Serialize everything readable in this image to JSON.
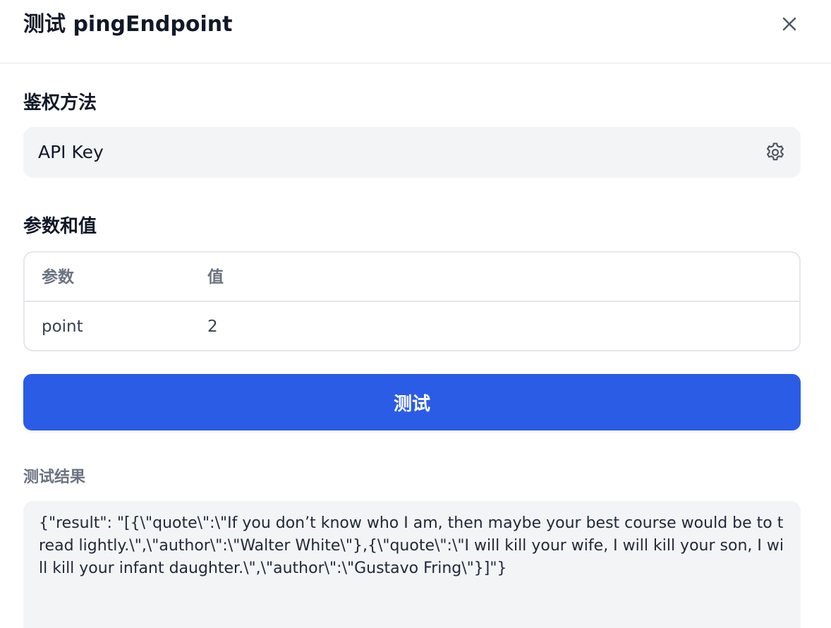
{
  "header": {
    "title": "测试 pingEndpoint"
  },
  "auth": {
    "label": "鉴权方法",
    "value": "API Key"
  },
  "params": {
    "label": "参数和值",
    "columns": [
      "参数",
      "值"
    ],
    "rows": [
      [
        "point",
        "2"
      ]
    ]
  },
  "actions": {
    "test_label": "测试",
    "test_color": "#2b5ce6"
  },
  "result": {
    "label": "测试结果",
    "text": "{\"result\": \"[{\\\"quote\\\":\\\"If you don’t know who I am, then maybe your best course would be to tread lightly.\\\",\\\"author\\\":\\\"Walter White\\\"},{\\\"quote\\\":\\\"I will kill your wife, I will kill your son, I will kill your infant daughter.\\\",\\\"author\\\":\\\"Gustavo Fring\\\"}]\"}"
  },
  "icons": {
    "close": "close-icon",
    "settings": "gear-icon"
  }
}
